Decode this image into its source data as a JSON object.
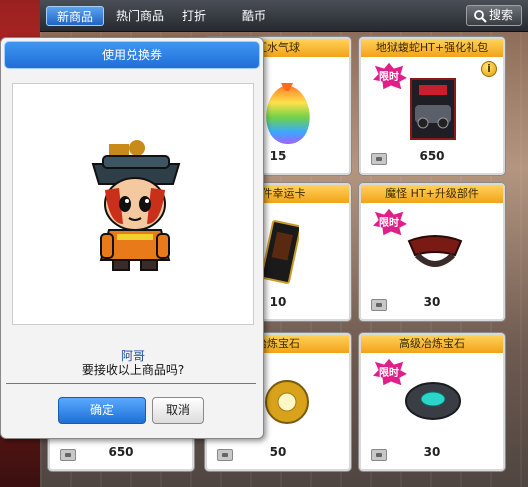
{
  "nav": {
    "tabs": [
      {
        "label": "新商品",
        "active": true
      },
      {
        "label": "热门商品",
        "active": false
      },
      {
        "label": "打折",
        "active": false
      },
      {
        "label": "酷币",
        "active": false
      }
    ],
    "search_label": "搜索"
  },
  "cards": [
    {
      "title": "汇水气球",
      "price": "15",
      "limited": false
    },
    {
      "title": "地狱蝮蛇HT+强化礼包",
      "price": "650",
      "limited": true,
      "limited_label": "限时",
      "info": "i"
    },
    {
      "title": "部件幸运卡",
      "price": "10",
      "limited": false
    },
    {
      "title": "魔怪 HT+升级部件",
      "price": "30",
      "limited": true,
      "limited_label": "限时"
    },
    {
      "title": "",
      "price": "650",
      "limited": false
    },
    {
      "title": "冶炼宝石",
      "price": "50",
      "limited": false
    },
    {
      "title": "高级冶炼宝石",
      "price": "30",
      "limited": true,
      "limited_label": "限时"
    }
  ],
  "dialog": {
    "title": "使用兑换券",
    "item_name": "阿哥",
    "question": "要接收以上商品吗?",
    "ok_label": "确定",
    "cancel_label": "取消"
  },
  "colors": {
    "accent_blue": "#2163c9",
    "card_header_orange": "#f2a21a",
    "limited_magenta": "#e0208a"
  }
}
